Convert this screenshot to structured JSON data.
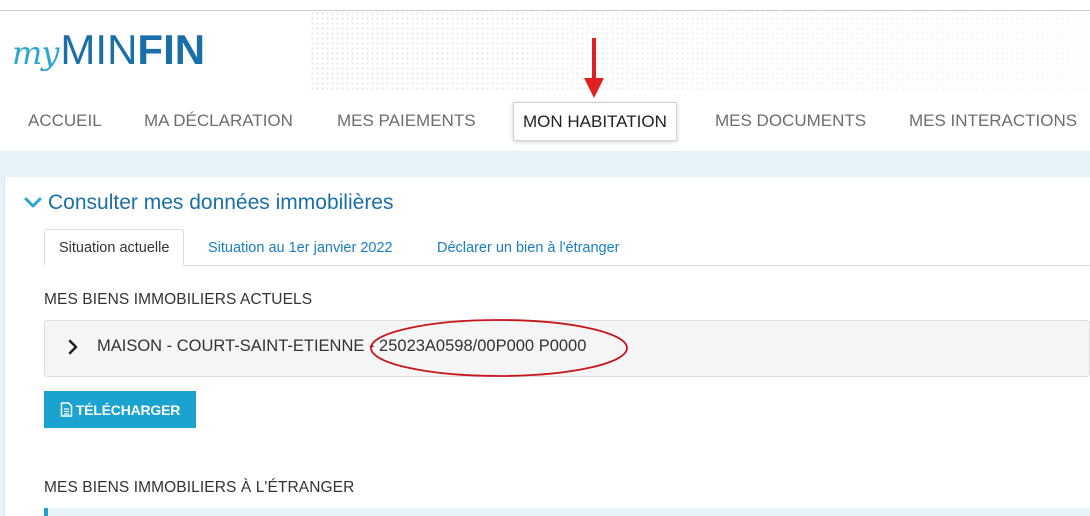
{
  "logo": {
    "my": "my",
    "min": "MIN",
    "fin": "FIN"
  },
  "nav": {
    "items": [
      {
        "label": "ACCUEIL"
      },
      {
        "label": "MA DÉCLARATION"
      },
      {
        "label": "MES PAIEMENTS"
      },
      {
        "label": "MON HABITATION"
      },
      {
        "label": "MES DOCUMENTS"
      },
      {
        "label": "MES INTERACTIONS"
      }
    ],
    "active_index": 3
  },
  "section": {
    "title": "Consulter mes données immobilières"
  },
  "tabs": [
    {
      "label": "Situation actuelle"
    },
    {
      "label": "Situation au 1er janvier 2022"
    },
    {
      "label": "Déclarer un bien à l'étranger"
    }
  ],
  "current_properties": {
    "heading": "MES BIENS IMMOBILIERS ACTUELS",
    "items": [
      {
        "label": "MAISON - COURT-SAINT-ETIENNE - 25023A0598/00P000 P0000"
      }
    ],
    "download_label": "TÉLÉCHARGER"
  },
  "foreign_properties": {
    "heading": "MES BIENS IMMOBILIERS À L'ÉTRANGER"
  },
  "annotation_colors": {
    "arrow": "#e02020",
    "ellipse": "#c8161d"
  },
  "colors": {
    "brand_blue": "#1a6fa8",
    "accent_cyan": "#1aa3cf",
    "link_blue": "#1a7ec2"
  }
}
